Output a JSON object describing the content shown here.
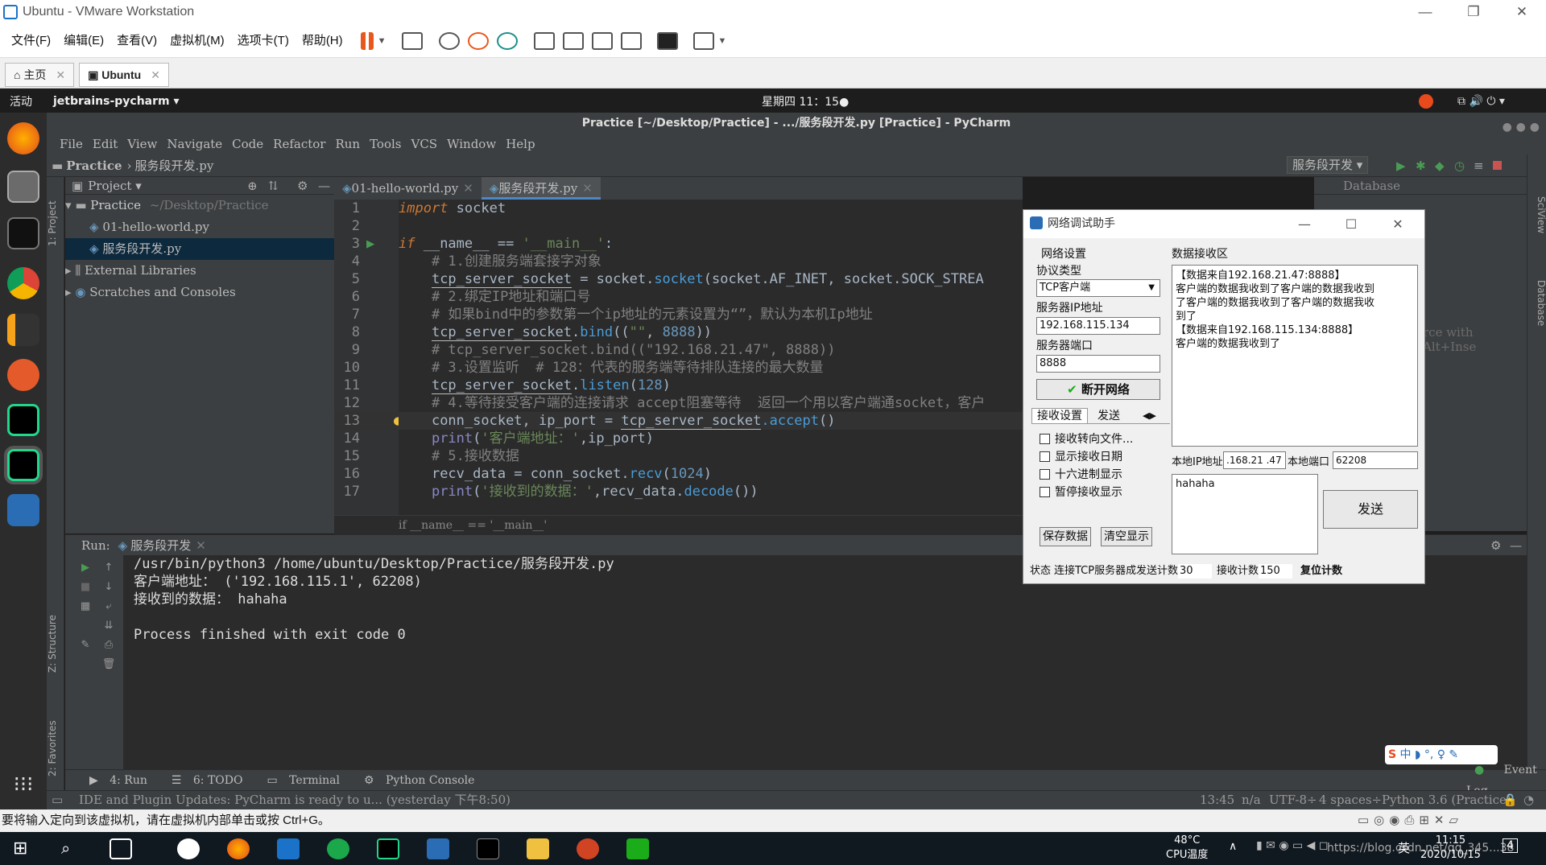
{
  "vmware": {
    "title": "Ubuntu - VMware Workstation",
    "menu": [
      "文件(F)",
      "编辑(E)",
      "查看(V)",
      "虚拟机(M)",
      "选项卡(T)",
      "帮助(H)"
    ],
    "tabs": [
      {
        "label": "主页"
      },
      {
        "label": "Ubuntu"
      }
    ],
    "hint": "要将输入定向到该虚拟机，请在虚拟机内部单击或按 Ctrl+G。"
  },
  "ubuntu": {
    "activities": "活动",
    "app": "jetbrains-pycharm ▾",
    "clock": "星期四 11：15●"
  },
  "pycharm": {
    "title": "Practice [~/Desktop/Practice] - .../服务段开发.py [Practice] - PyCharm",
    "menu": [
      "File",
      "Edit",
      "View",
      "Navigate",
      "Code",
      "Refactor",
      "Run",
      "Tools",
      "VCS",
      "Window",
      "Help"
    ],
    "nav": {
      "project": "Practice",
      "file": "服务段开发.py",
      "run_config": "服务段开发 ▾"
    },
    "project_panel": {
      "header": "Project ▾",
      "root": "Practice",
      "root_path": "~/Desktop/Practice",
      "files": [
        "01-hello-world.py",
        "服务段开发.py"
      ],
      "external": "External Libraries",
      "scratches": "Scratches and Consoles"
    },
    "side_labels": {
      "project": "1: Project",
      "structure": "Z: Structure",
      "favorites": "2: Favorites",
      "sciview": "SciView",
      "database": "Database"
    },
    "editor_tabs": [
      "01-hello-world.py",
      "服务段开发.py"
    ],
    "line_numbers": [
      "1",
      "2",
      "3",
      "4",
      "5",
      "6",
      "7",
      "8",
      "9",
      "10",
      "11",
      "12",
      "13",
      "14",
      "15",
      "16",
      "17"
    ],
    "code": {
      "l1_kw": "import",
      "l1_rest": " socket",
      "l3_kw": "if",
      "l3_a": " __name__ == ",
      "l3_s": "'__main__'",
      "l3_b": ":",
      "l4": "    # 1.创建服务端套接字对象",
      "l5_v": "tcp_server_socket",
      "l5_a": " = socket.",
      "l5_f": "socket",
      "l5_b": "(socket.AF_INET, socket.SOCK_STREA",
      "l6": "    # 2.绑定IP地址和端口号",
      "l7": "    # 如果bind中的参数第一个ip地址的元素设置为“”，默认为本机Ip地址",
      "l8_v": "tcp_server_socket",
      "l8_a": ".",
      "l8_f": "bind",
      "l8_b": "((",
      "l8_s": "\"\"",
      "l8_c": ", ",
      "l8_n": "8888",
      "l8_d": "))",
      "l9": "    # tcp_server_socket.bind((\"192.168.21.47\", 8888))",
      "l10": "    # 3.设置监听  # 128：代表的服务端等待排队连接的最大数量",
      "l11_v": "tcp_server_socket",
      "l11_a": ".",
      "l11_f": "listen",
      "l11_b": "(",
      "l11_n": "128",
      "l11_c": ")",
      "l12": "    # 4.等待接受客户端的连接请求 accept阻塞等待  返回一个用以客户端通socket，客户",
      "l13_a": "conn_socket, ip_port = ",
      "l13_v": "tcp_server_socket",
      "l13_f": ".accept",
      "l13_b": "()",
      "l14_p": "print",
      "l14_a": "(",
      "l14_s": "'客户端地址：'",
      "l14_b": ",ip_port)",
      "l15": "    # 5.接收数据",
      "l16_a": "recv_data = conn_socket.",
      "l16_f": "recv",
      "l16_b": "(",
      "l16_n": "1024",
      "l16_c": ")",
      "l17_p": "print",
      "l17_a": "(",
      "l17_s": "'接收到的数据：'",
      "l17_b": ",recv_data.",
      "l17_f": "decode",
      "l17_c": "())"
    },
    "breadcrumb": "if __name__ == '__main__'",
    "right_panel": {
      "title": "Database",
      "hint": "rce with Alt+Inse"
    },
    "run": {
      "label": "Run:",
      "tab": "服务段开发",
      "output": [
        "/usr/bin/python3 /home/ubuntu/Desktop/Practice/服务段开发.py",
        "客户端地址： ('192.168.115.1', 62208)",
        "接收到的数据： hahaha",
        "",
        "Process finished with exit code 0"
      ]
    },
    "bottom_tabs": [
      "4: Run",
      "6: TODO",
      "Terminal",
      "Python Console",
      "Event Log"
    ],
    "status": {
      "message": "IDE and Plugin Updates: PyCharm is ready to u... (yesterday 下午8:50)",
      "position": "13:45",
      "na": "n/a",
      "encoding": "UTF-8÷",
      "indent": "4 spaces÷",
      "interpreter": "Python 3.6 (Practice)"
    }
  },
  "net_assistant": {
    "title": "网络调试助手",
    "net_settings": "网络设置",
    "protocol_label": "协议类型",
    "protocol_value": "TCP客户端",
    "server_ip_label": "服务器IP地址",
    "server_ip": "192.168.115.134",
    "server_port_label": "服务器端口",
    "server_port": "8888",
    "disconnect": "断开网络",
    "recv_tab": "接收设置",
    "send_tab": "发送",
    "options": [
      "接收转向文件...",
      "显示接收日期",
      "十六进制显示",
      "暂停接收显示"
    ],
    "save_btn": "保存数据",
    "clear_btn": "清空显示",
    "recv_area_label": "数据接收区",
    "recv_text": [
      "【数据来自192.168.21.47:8888】",
      "客户端的数据我收到了客户端的数据我收到",
      "了客户端的数据我收到了客户端的数据我收",
      "到了",
      "【数据来自192.168.115.134:8888】",
      "客户端的数据我收到了"
    ],
    "local_ip_label": "本地IP地址",
    "local_ip": ".168.21 .47",
    "local_port_label": "本地端口",
    "local_port": "62208",
    "send_text": "hahaha",
    "send_btn": "发送",
    "status_label": "状态",
    "status_value": "连接TCP服务器成",
    "send_count_label": "发送计数",
    "send_count": "30",
    "recv_count_label": "接收计数",
    "recv_count": "150",
    "reset_count": "复位计数"
  },
  "taskbar": {
    "temp": "48°C",
    "temp_label": "CPU温度",
    "ime": "英",
    "time": "11:15",
    "date": "2020/10/15",
    "watermark": "https://blog.csdn.net/qq_345...38",
    "badge": "4"
  },
  "colors": {
    "accent": "#4a88c7",
    "editor_bg": "#2b2b2b",
    "panel_bg": "#3c3f41",
    "keyword": "#cc7832",
    "string": "#6a8759",
    "comment": "#808080",
    "number": "#6897bb"
  }
}
